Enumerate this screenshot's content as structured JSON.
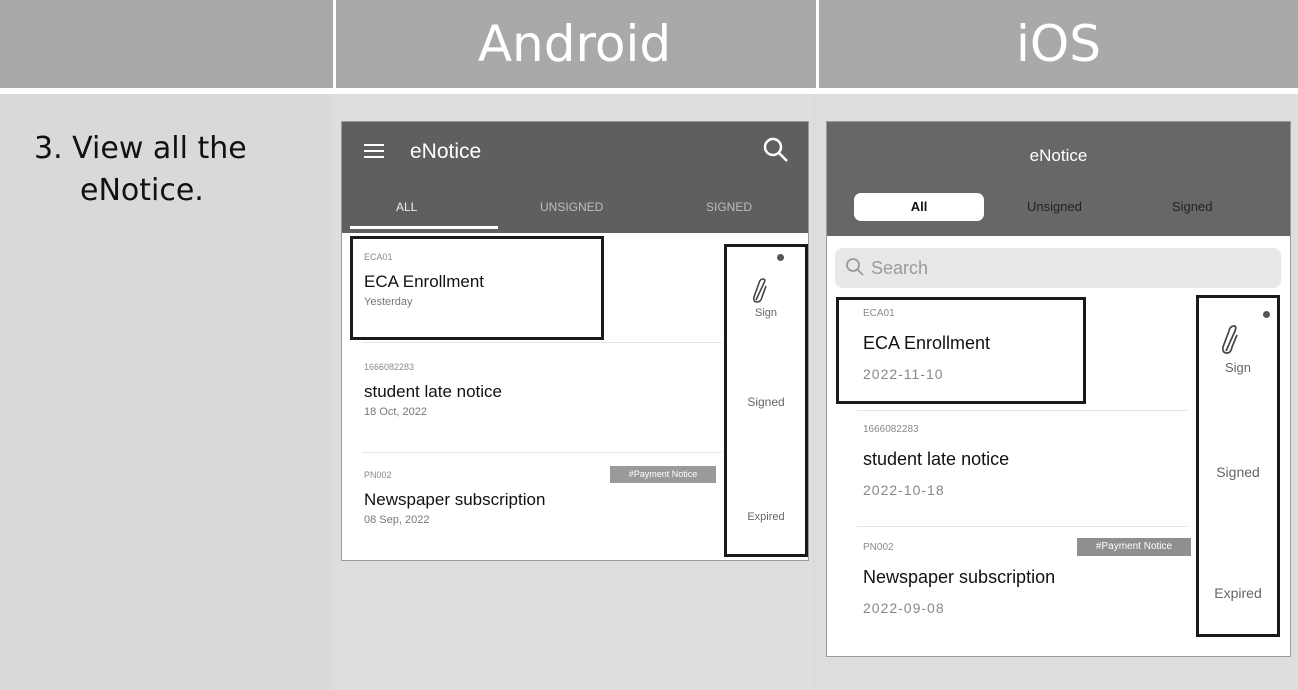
{
  "header": {
    "col1": "",
    "col2": "Android",
    "col3": "iOS"
  },
  "step": {
    "line1": "3. View all the",
    "line2": "eNotice."
  },
  "android": {
    "app_title": "eNotice",
    "tabs": [
      "ALL",
      "UNSIGNED",
      "SIGNED"
    ],
    "active_tab": "ALL",
    "notices": [
      {
        "code": "ECA01",
        "title": "ECA Enrollment",
        "date": "Yesterday",
        "status": "Sign"
      },
      {
        "code": "1666082283",
        "title": "student late notice",
        "date": "18 Oct, 2022",
        "status": "Signed"
      },
      {
        "code": "PN002",
        "title": "Newspaper subscription",
        "date": "08 Sep, 2022",
        "status": "Expired",
        "tag": "#Payment Notice"
      }
    ]
  },
  "ios": {
    "app_title": "eNotice",
    "segments": [
      "All",
      "Unsigned",
      "Signed"
    ],
    "active_segment": "All",
    "search_placeholder": "Search",
    "notices": [
      {
        "code": "ECA01",
        "title": "ECA Enrollment",
        "date": "2022-11-10",
        "status": "Sign"
      },
      {
        "code": "1666082283",
        "title": "student late notice",
        "date": "2022-10-18",
        "status": "Signed"
      },
      {
        "code": "PN002",
        "title": "Newspaper subscription",
        "date": "2022-09-08",
        "status": "Expired",
        "tag": "#Payment Notice"
      }
    ]
  },
  "colors": {
    "header_bg": "#a9a9a9",
    "appbar_bg": "#5f5f5f",
    "highlight_border": "#1a1a1a"
  }
}
